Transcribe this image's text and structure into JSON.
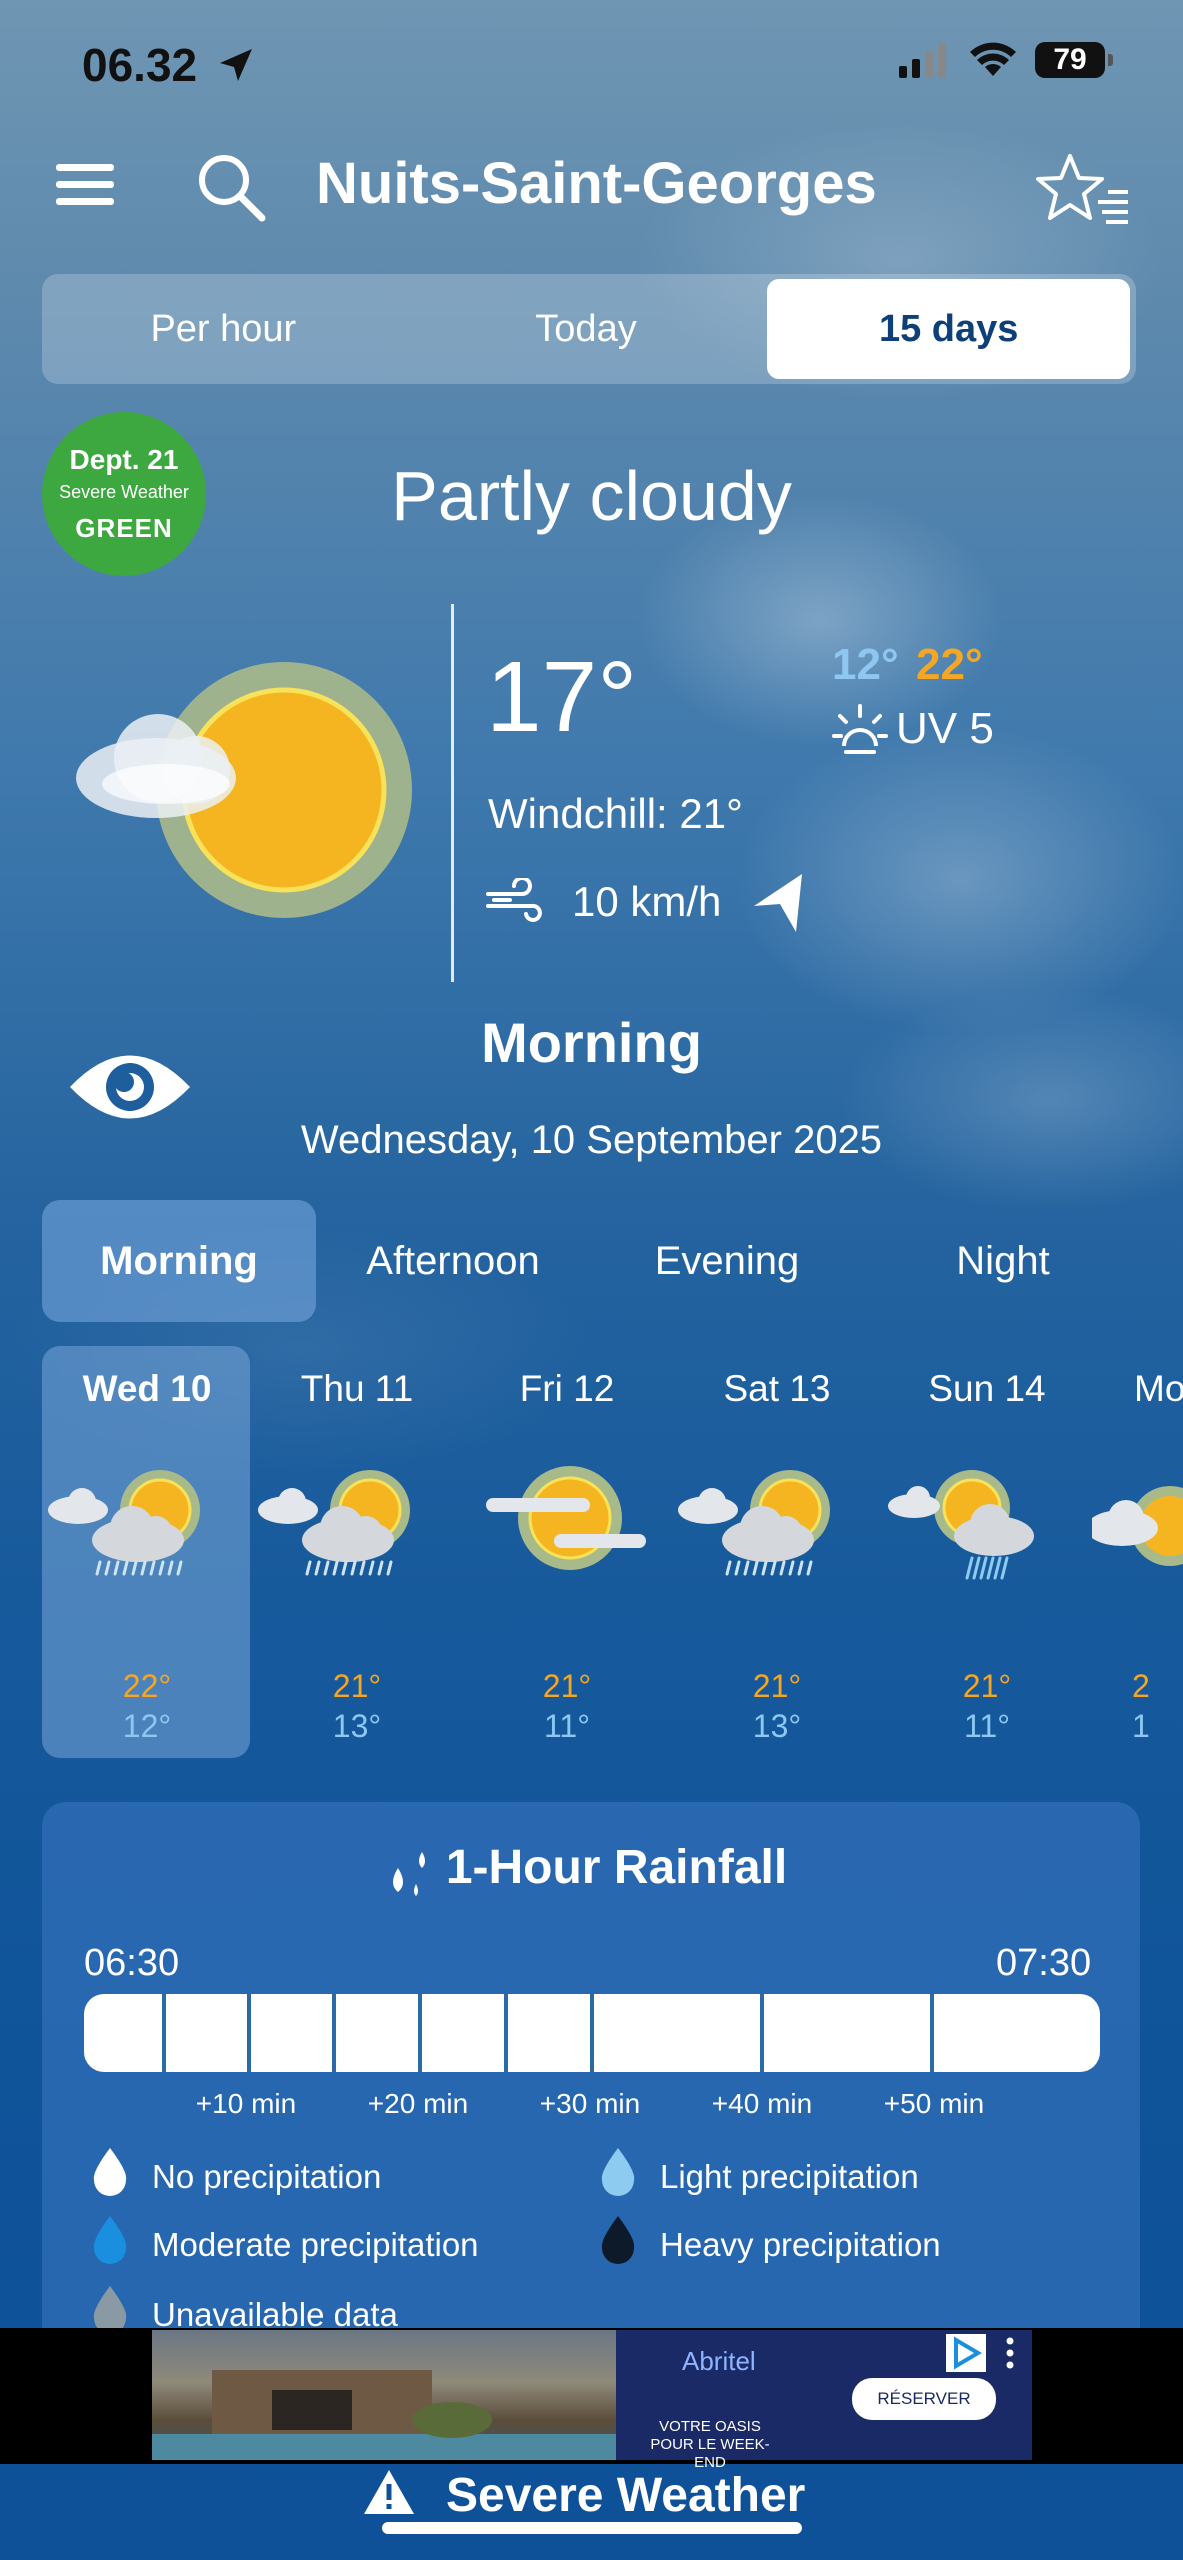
{
  "status": {
    "time": "06.32",
    "battery": "79"
  },
  "header": {
    "city": "Nuits-Saint-Georges"
  },
  "tabs": [
    "Per hour",
    "Today",
    "15 days"
  ],
  "alert": {
    "dept": "Dept. 21",
    "subtitle": "Severe Weather",
    "level": "GREEN"
  },
  "current": {
    "condition": "Partly cloudy",
    "temp": "17°",
    "min": "12°",
    "max": "22°",
    "uv": "UV 5",
    "windchill": "Windchill: 21°",
    "wind": "10 km/h"
  },
  "period": {
    "title": "Morning",
    "date": "Wednesday, 10 September 2025"
  },
  "period_tabs": [
    "Morning",
    "Afternoon",
    "Evening",
    "Night"
  ],
  "days": [
    {
      "name": "Wed 10",
      "hi": "22°",
      "lo": "12°",
      "icon": "sun-cloud-rain-icon"
    },
    {
      "name": "Thu 11",
      "hi": "21°",
      "lo": "13°",
      "icon": "sun-cloud-rain-icon"
    },
    {
      "name": "Fri 12",
      "hi": "21°",
      "lo": "11°",
      "icon": "sun-haze-icon"
    },
    {
      "name": "Sat 13",
      "hi": "21°",
      "lo": "13°",
      "icon": "sun-cloud-rain-icon"
    },
    {
      "name": "Sun 14",
      "hi": "21°",
      "lo": "11°",
      "icon": "sun-cloud-showers-icon"
    },
    {
      "name": "Mo",
      "hi": "2",
      "lo": "1",
      "icon": "sun-cloud-icon"
    }
  ],
  "rainfall": {
    "title": "1-Hour Rainfall",
    "start": "06:30",
    "end": "07:30",
    "ticks": [
      "+10 min",
      "+20 min",
      "+30 min",
      "+40 min",
      "+50 min"
    ],
    "legend": [
      "No precipitation",
      "Light precipitation",
      "Moderate precipitation",
      "Heavy precipitation",
      "Unavailable data"
    ]
  },
  "ad": {
    "brand": "Abritel",
    "button": "RÉSERVER",
    "tagline": "VOTRE OASIS POUR LE WEEK-END"
  },
  "footer": {
    "severe": "Severe Weather"
  },
  "colors": {
    "hi": "#f5a623",
    "lo": "#8ec8f2",
    "badge": "#3da83f"
  }
}
